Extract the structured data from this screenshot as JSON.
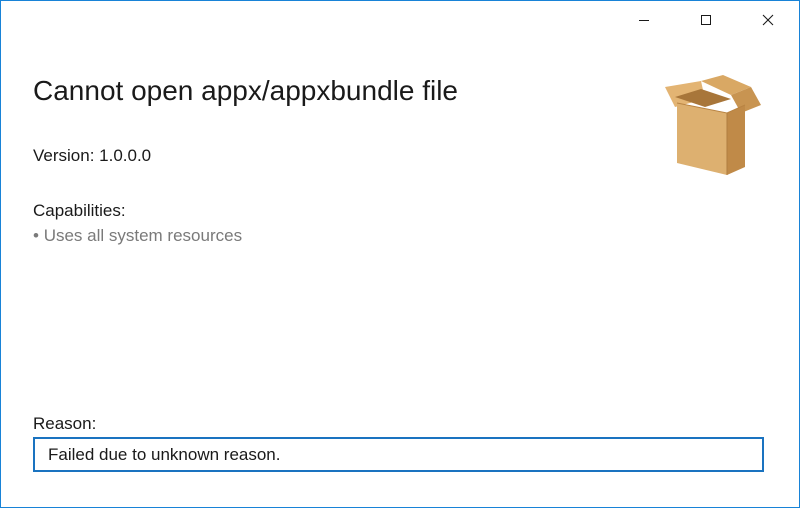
{
  "window": {
    "caption_buttons": [
      "minimize-icon",
      "maximize-icon",
      "close-icon"
    ],
    "accent_color": "#1883d7"
  },
  "header": {
    "title": "Cannot open appx/appxbundle file",
    "package_icon": "package-box-icon"
  },
  "info": {
    "version_label": "Version: 1.0.0.0",
    "capabilities_label": "Capabilities:",
    "capabilities": [
      "Uses all system resources"
    ]
  },
  "reason": {
    "label": "Reason:",
    "value": "Failed due to unknown reason."
  }
}
